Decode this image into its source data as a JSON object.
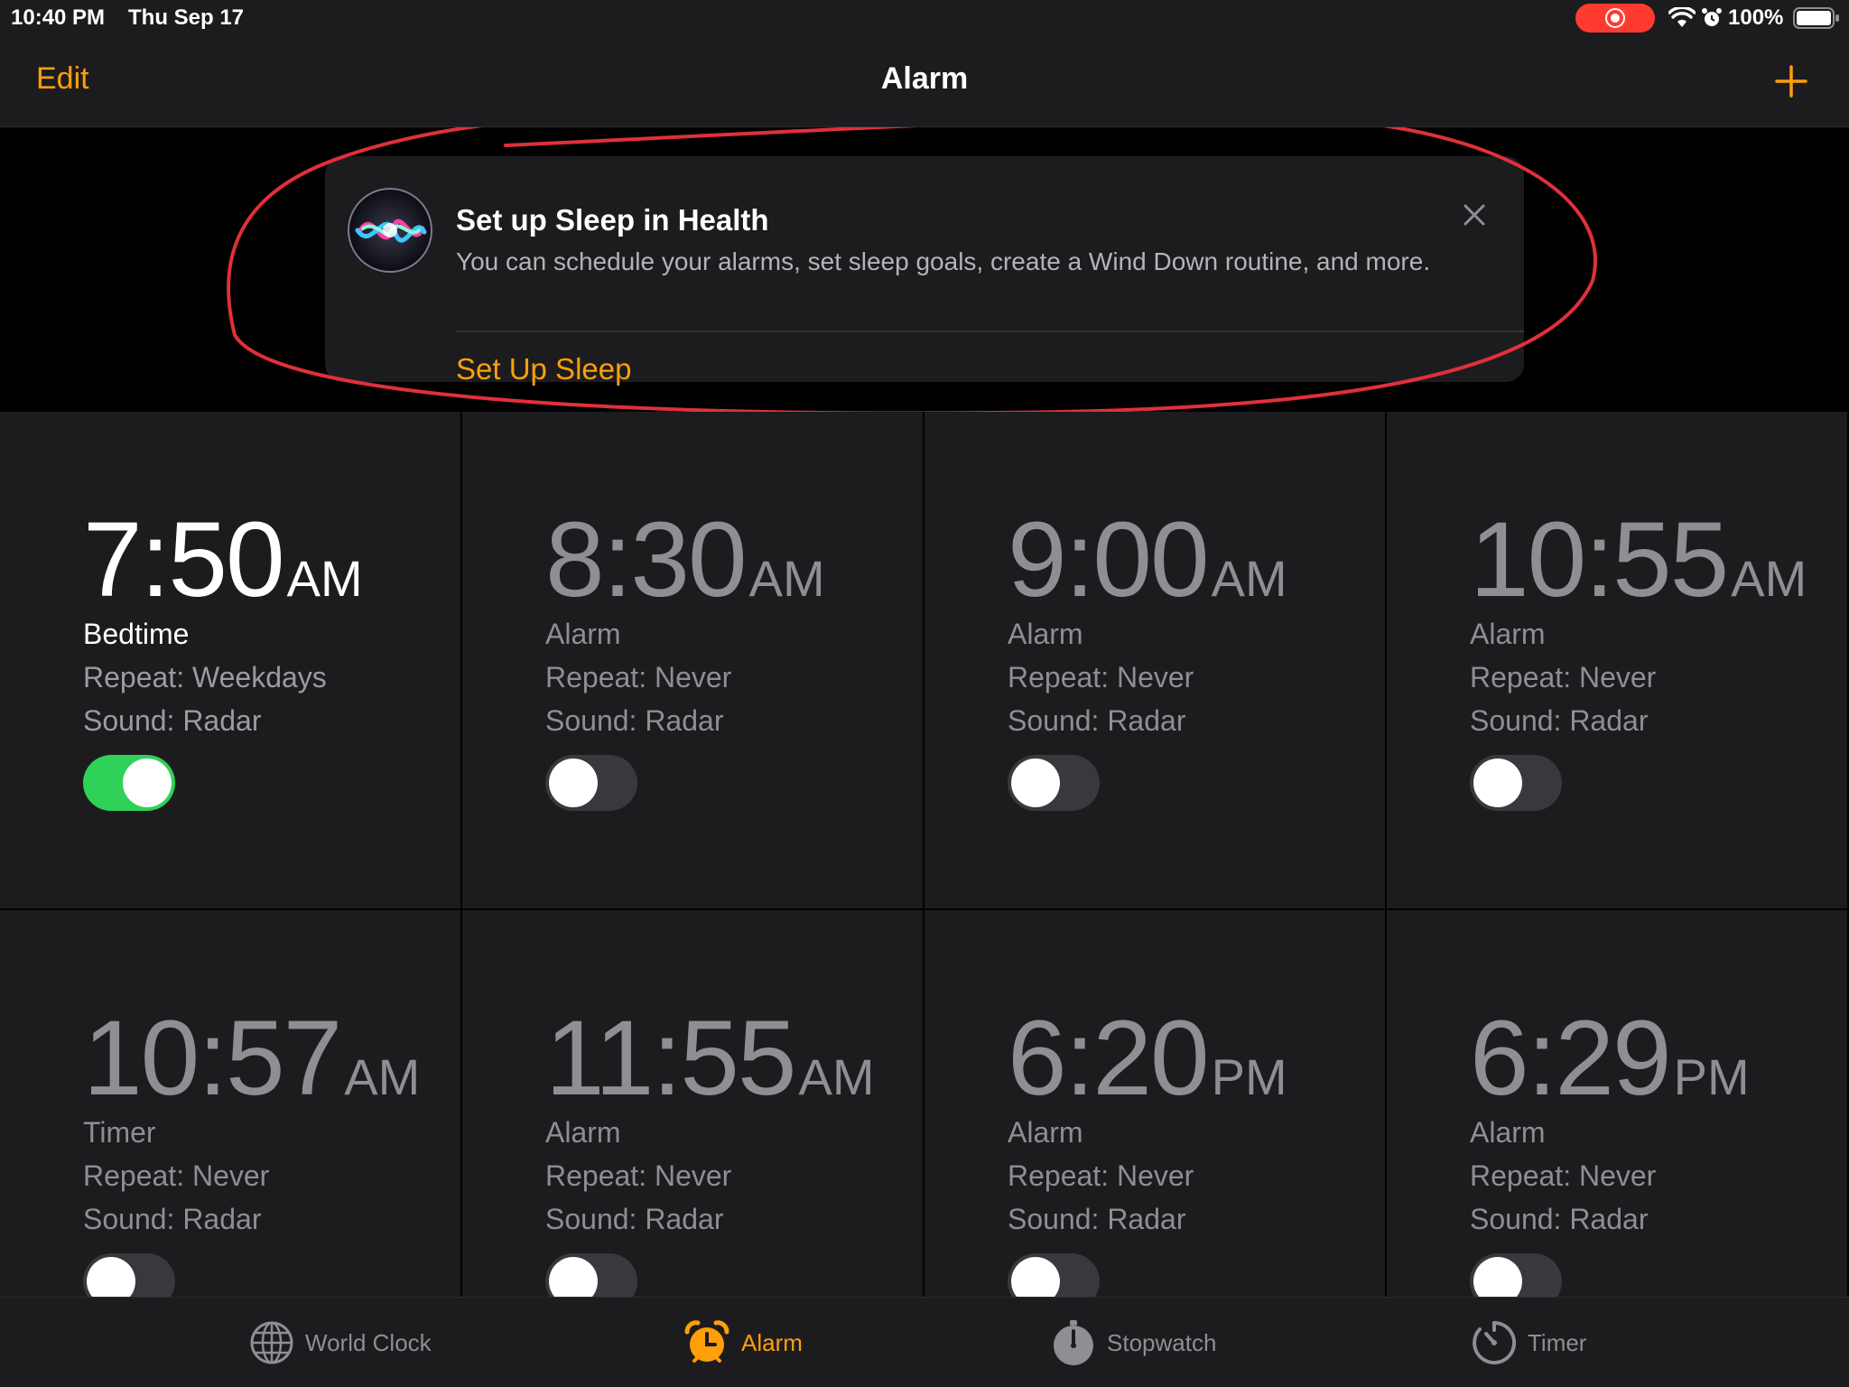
{
  "status_bar": {
    "time": "10:40 PM",
    "date": "Thu Sep 17",
    "battery": "100%",
    "record_color": "#ff3b30"
  },
  "nav": {
    "edit_label": "Edit",
    "title": "Alarm",
    "add_icon": "plus-icon"
  },
  "banner": {
    "icon": "siri-icon",
    "title": "Set up Sleep in Health",
    "body": "You can schedule your alarms, set sleep goals, create a Wind Down routine, and more.",
    "action": "Set Up Sleep",
    "close_icon": "close-icon"
  },
  "alarms": [
    {
      "time": "7:50",
      "period": "AM",
      "label": "Bedtime",
      "repeat": "Repeat: Weekdays",
      "sound": "Sound: Radar",
      "enabled": true
    },
    {
      "time": "8:30",
      "period": "AM",
      "label": "Alarm",
      "repeat": "Repeat: Never",
      "sound": "Sound: Radar",
      "enabled": false
    },
    {
      "time": "9:00",
      "period": "AM",
      "label": "Alarm",
      "repeat": "Repeat: Never",
      "sound": "Sound: Radar",
      "enabled": false
    },
    {
      "time": "10:55",
      "period": "AM",
      "label": "Alarm",
      "repeat": "Repeat: Never",
      "sound": "Sound: Radar",
      "enabled": false
    },
    {
      "time": "10:57",
      "period": "AM",
      "label": "Timer",
      "repeat": "Repeat: Never",
      "sound": "Sound: Radar",
      "enabled": false
    },
    {
      "time": "11:55",
      "period": "AM",
      "label": "Alarm",
      "repeat": "Repeat: Never",
      "sound": "Sound: Radar",
      "enabled": false
    },
    {
      "time": "6:20",
      "period": "PM",
      "label": "Alarm",
      "repeat": "Repeat: Never",
      "sound": "Sound: Radar",
      "enabled": false
    },
    {
      "time": "6:29",
      "period": "PM",
      "label": "Alarm",
      "repeat": "Repeat: Never",
      "sound": "Sound: Radar",
      "enabled": false
    }
  ],
  "tabs": [
    {
      "label": "World Clock",
      "icon": "globe-icon",
      "active": false
    },
    {
      "label": "Alarm",
      "icon": "alarm-clock-icon",
      "active": true
    },
    {
      "label": "Stopwatch",
      "icon": "stopwatch-icon",
      "active": false
    },
    {
      "label": "Timer",
      "icon": "timer-icon",
      "active": false
    }
  ],
  "colors": {
    "accent": "#ff9f0a",
    "toggle_on": "#30d158",
    "background": "#000000",
    "cell": "#1c1c1e",
    "annotation": "#e0303a"
  }
}
